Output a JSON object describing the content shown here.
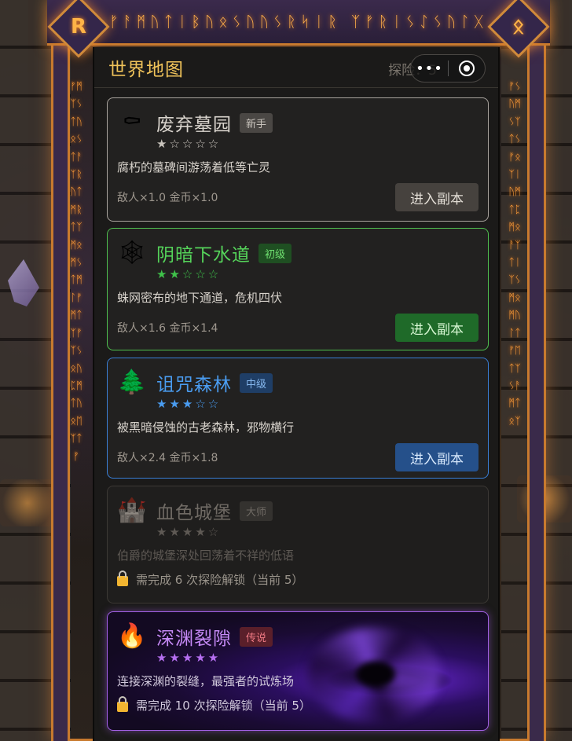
{
  "frame": {
    "corner_left_rune": "R",
    "corner_right_rune": "ᛟ",
    "top_runes": "ᚠᚨᛗᚢᛏᛁᛒᚢᛟᛊᚢᚢᛊᚱᛋᛁᚱ ᛉᚠᚱᛁᛊᛇᛊᚢᛚᚷ",
    "left_runes": "ᚠᛗᛉᛊᛏᚢᛟᛊᛏᚨᛉᚱᚢᛏᛗᚱᛏᛉᛗᛟᛗᛊᛏᛗᛚᚠᛗᛏᛉᚠᛉᛊᛟᚢᛈᛗᛏᚢᛟᛖᛉᛏᚠ",
    "right_runes": "ᚠᛊᚢᛗᛊᛉᛏᛊᚠᛟᛉᛁᚢᛗᛏᛈᛗᛟᚨᛉᛏᛁᛉᛊᛗᛟᛗᚢᛚᛏᚠᛖᛏᛉᛊᚨᛗᛏᛟᛉ"
  },
  "header": {
    "title": "世界地图",
    "explore_text": "探险：5",
    "more_glyph": "•••"
  },
  "cards": [
    {
      "icon": "coffin-icon",
      "icon_glyph": "⚰",
      "name": "废弃墓园",
      "badge": "新手",
      "stars": "★☆☆☆☆",
      "desc": "腐朽的墓碑间游荡着低等亡灵",
      "mult": "敌人×1.0  金币×1.0",
      "button": "进入副本",
      "color": "#a8a39d"
    },
    {
      "icon": "spiderweb-icon",
      "icon_glyph": "🕸",
      "name": "阴暗下水道",
      "badge": "初级",
      "stars": "★★☆☆☆",
      "desc": "蛛网密布的地下通道，危机四伏",
      "mult": "敌人×1.6  金币×1.4",
      "button": "进入副本",
      "color": "#4fc04f"
    },
    {
      "icon": "tree-icon",
      "icon_glyph": "🌲",
      "name": "诅咒森林",
      "badge": "中级",
      "stars": "★★★☆☆",
      "desc": "被黑暗侵蚀的古老森林，邪物横行",
      "mult": "敌人×2.4  金币×1.8",
      "button": "进入副本",
      "color": "#3a7fd6"
    },
    {
      "icon": "castle-icon",
      "icon_glyph": "🏰",
      "name": "血色城堡",
      "badge": "大师",
      "stars": "★★★★☆",
      "desc": "伯爵的城堡深处回荡着不祥的低语",
      "lock_text": "需完成 6 次探险解锁（当前 5）",
      "color": "#3c3935"
    },
    {
      "icon": "fire-icon",
      "icon_glyph": "🔥",
      "name": "深渊裂隙",
      "badge": "传说",
      "stars": "★★★★★",
      "desc": "连接深渊的裂缝，最强者的试炼场",
      "lock_text": "需完成 10 次探险解锁（当前 5）",
      "color": "#a360e6"
    }
  ]
}
